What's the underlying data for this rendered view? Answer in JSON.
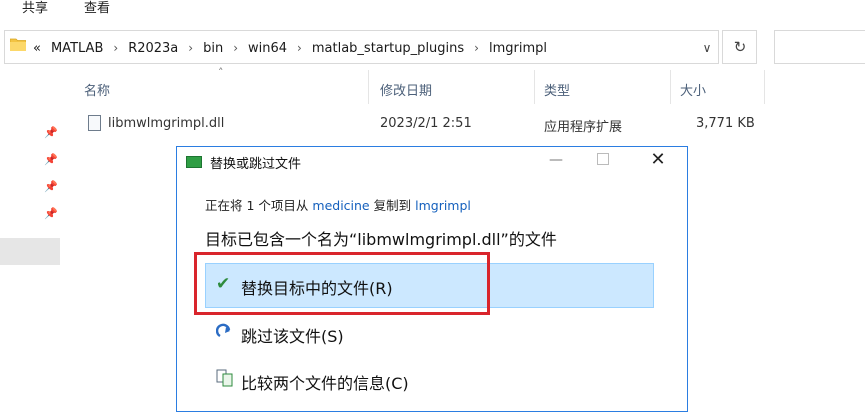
{
  "ribbon": {
    "tabs": [
      "共享",
      "查看"
    ]
  },
  "address": {
    "crumbs": [
      "«",
      "MATLAB",
      "R2023a",
      "bin",
      "win64",
      "matlab_startup_plugins",
      "lmgrimpl"
    ],
    "separator": "›"
  },
  "columns": {
    "name": "名称",
    "date": "修改日期",
    "type": "类型",
    "size": "大小"
  },
  "file": {
    "name": "libmwlmgrimpl.dll",
    "date": "2023/2/1 2:51",
    "type": "应用程序扩展",
    "size": "3,771 KB"
  },
  "dialog": {
    "title": "替换或跳过文件",
    "info": {
      "prefix": "正在将 1 个项目从",
      "source": "medicine",
      "middle": "复制到",
      "dest": "lmgrimpl"
    },
    "heading": "目标已包含一个名为“libmwlmgrimpl.dll”的文件",
    "options": {
      "replace": "替换目标中的文件(R)",
      "skip": "跳过该文件(S)",
      "compare": "比较两个文件的信息(C)"
    }
  },
  "colors": {
    "accent": "#2b7de1",
    "selection": "#cce8ff",
    "highlight_box": "#d9252c",
    "link": "#1560bd"
  }
}
